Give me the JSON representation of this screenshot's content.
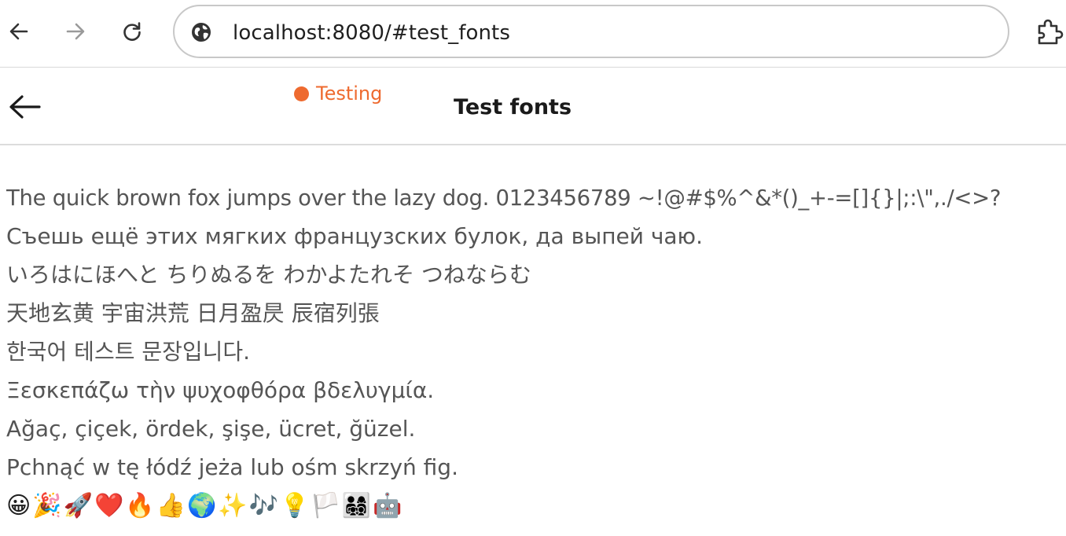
{
  "browser": {
    "url": "localhost:8080/#test_fonts",
    "icons": {
      "back": "arrow-left-icon",
      "forward": "arrow-right-icon",
      "reload": "reload-icon",
      "site": "globe-icon",
      "extensions": "puzzle-icon"
    }
  },
  "app": {
    "status_label": "Testing",
    "status_color": "#ee6a2f",
    "title": "Test fonts",
    "back_icon": "arrow-left-icon"
  },
  "samples": [
    "The quick brown fox jumps over the lazy dog. 0123456789 ~!@#$%^&*()_+-=[]{}|;:\\\",./<>?",
    "Съешь ещё этих мягких французских булок, да выпей чаю.",
    "いろはにほへと ちりぬるを わかよたれそ つねならむ",
    "天地玄黄 宇宙洪荒 日月盈昃 辰宿列張",
    "한국어 테스트 문장입니다.",
    "Ξεσκεπάζω τὴν ψυχοφθόρα βδελυγμία.",
    "Ağaç, çiçek, ördek, şişe, ücret, ğüzel.",
    "Pchnąć w tę łódź jeża lub ośm skrzyń fig."
  ],
  "emoji_line": "😀🎉🚀❤️🔥👍🌍✨🎶💡🏳️👨‍👩‍👧‍👦🤖"
}
